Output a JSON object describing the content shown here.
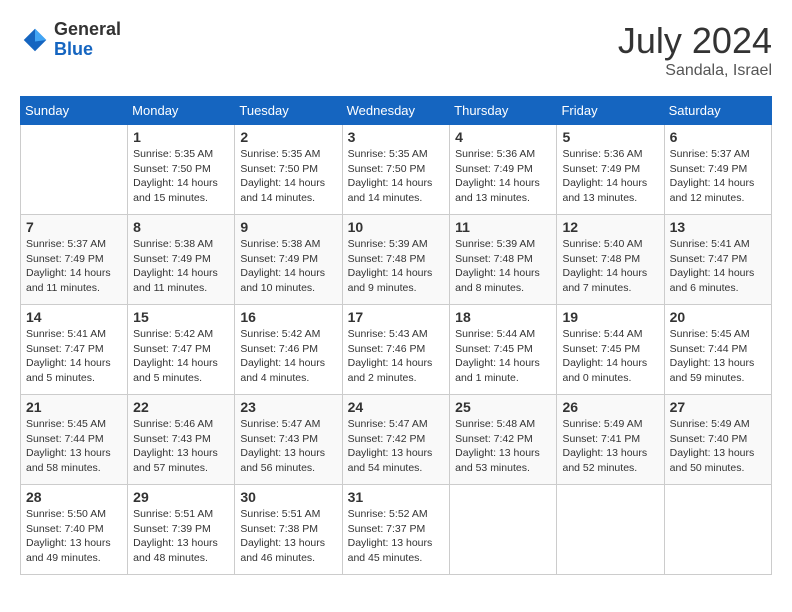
{
  "header": {
    "logo_general": "General",
    "logo_blue": "Blue",
    "month_title": "July 2024",
    "location": "Sandala, Israel"
  },
  "calendar": {
    "columns": [
      "Sunday",
      "Monday",
      "Tuesday",
      "Wednesday",
      "Thursday",
      "Friday",
      "Saturday"
    ],
    "weeks": [
      [
        {
          "day": "",
          "sunrise": "",
          "sunset": "",
          "daylight": ""
        },
        {
          "day": "1",
          "sunrise": "Sunrise: 5:35 AM",
          "sunset": "Sunset: 7:50 PM",
          "daylight": "Daylight: 14 hours and 15 minutes."
        },
        {
          "day": "2",
          "sunrise": "Sunrise: 5:35 AM",
          "sunset": "Sunset: 7:50 PM",
          "daylight": "Daylight: 14 hours and 14 minutes."
        },
        {
          "day": "3",
          "sunrise": "Sunrise: 5:35 AM",
          "sunset": "Sunset: 7:50 PM",
          "daylight": "Daylight: 14 hours and 14 minutes."
        },
        {
          "day": "4",
          "sunrise": "Sunrise: 5:36 AM",
          "sunset": "Sunset: 7:49 PM",
          "daylight": "Daylight: 14 hours and 13 minutes."
        },
        {
          "day": "5",
          "sunrise": "Sunrise: 5:36 AM",
          "sunset": "Sunset: 7:49 PM",
          "daylight": "Daylight: 14 hours and 13 minutes."
        },
        {
          "day": "6",
          "sunrise": "Sunrise: 5:37 AM",
          "sunset": "Sunset: 7:49 PM",
          "daylight": "Daylight: 14 hours and 12 minutes."
        }
      ],
      [
        {
          "day": "7",
          "sunrise": "Sunrise: 5:37 AM",
          "sunset": "Sunset: 7:49 PM",
          "daylight": "Daylight: 14 hours and 11 minutes."
        },
        {
          "day": "8",
          "sunrise": "Sunrise: 5:38 AM",
          "sunset": "Sunset: 7:49 PM",
          "daylight": "Daylight: 14 hours and 11 minutes."
        },
        {
          "day": "9",
          "sunrise": "Sunrise: 5:38 AM",
          "sunset": "Sunset: 7:49 PM",
          "daylight": "Daylight: 14 hours and 10 minutes."
        },
        {
          "day": "10",
          "sunrise": "Sunrise: 5:39 AM",
          "sunset": "Sunset: 7:48 PM",
          "daylight": "Daylight: 14 hours and 9 minutes."
        },
        {
          "day": "11",
          "sunrise": "Sunrise: 5:39 AM",
          "sunset": "Sunset: 7:48 PM",
          "daylight": "Daylight: 14 hours and 8 minutes."
        },
        {
          "day": "12",
          "sunrise": "Sunrise: 5:40 AM",
          "sunset": "Sunset: 7:48 PM",
          "daylight": "Daylight: 14 hours and 7 minutes."
        },
        {
          "day": "13",
          "sunrise": "Sunrise: 5:41 AM",
          "sunset": "Sunset: 7:47 PM",
          "daylight": "Daylight: 14 hours and 6 minutes."
        }
      ],
      [
        {
          "day": "14",
          "sunrise": "Sunrise: 5:41 AM",
          "sunset": "Sunset: 7:47 PM",
          "daylight": "Daylight: 14 hours and 5 minutes."
        },
        {
          "day": "15",
          "sunrise": "Sunrise: 5:42 AM",
          "sunset": "Sunset: 7:47 PM",
          "daylight": "Daylight: 14 hours and 5 minutes."
        },
        {
          "day": "16",
          "sunrise": "Sunrise: 5:42 AM",
          "sunset": "Sunset: 7:46 PM",
          "daylight": "Daylight: 14 hours and 4 minutes."
        },
        {
          "day": "17",
          "sunrise": "Sunrise: 5:43 AM",
          "sunset": "Sunset: 7:46 PM",
          "daylight": "Daylight: 14 hours and 2 minutes."
        },
        {
          "day": "18",
          "sunrise": "Sunrise: 5:44 AM",
          "sunset": "Sunset: 7:45 PM",
          "daylight": "Daylight: 14 hours and 1 minute."
        },
        {
          "day": "19",
          "sunrise": "Sunrise: 5:44 AM",
          "sunset": "Sunset: 7:45 PM",
          "daylight": "Daylight: 14 hours and 0 minutes."
        },
        {
          "day": "20",
          "sunrise": "Sunrise: 5:45 AM",
          "sunset": "Sunset: 7:44 PM",
          "daylight": "Daylight: 13 hours and 59 minutes."
        }
      ],
      [
        {
          "day": "21",
          "sunrise": "Sunrise: 5:45 AM",
          "sunset": "Sunset: 7:44 PM",
          "daylight": "Daylight: 13 hours and 58 minutes."
        },
        {
          "day": "22",
          "sunrise": "Sunrise: 5:46 AM",
          "sunset": "Sunset: 7:43 PM",
          "daylight": "Daylight: 13 hours and 57 minutes."
        },
        {
          "day": "23",
          "sunrise": "Sunrise: 5:47 AM",
          "sunset": "Sunset: 7:43 PM",
          "daylight": "Daylight: 13 hours and 56 minutes."
        },
        {
          "day": "24",
          "sunrise": "Sunrise: 5:47 AM",
          "sunset": "Sunset: 7:42 PM",
          "daylight": "Daylight: 13 hours and 54 minutes."
        },
        {
          "day": "25",
          "sunrise": "Sunrise: 5:48 AM",
          "sunset": "Sunset: 7:42 PM",
          "daylight": "Daylight: 13 hours and 53 minutes."
        },
        {
          "day": "26",
          "sunrise": "Sunrise: 5:49 AM",
          "sunset": "Sunset: 7:41 PM",
          "daylight": "Daylight: 13 hours and 52 minutes."
        },
        {
          "day": "27",
          "sunrise": "Sunrise: 5:49 AM",
          "sunset": "Sunset: 7:40 PM",
          "daylight": "Daylight: 13 hours and 50 minutes."
        }
      ],
      [
        {
          "day": "28",
          "sunrise": "Sunrise: 5:50 AM",
          "sunset": "Sunset: 7:40 PM",
          "daylight": "Daylight: 13 hours and 49 minutes."
        },
        {
          "day": "29",
          "sunrise": "Sunrise: 5:51 AM",
          "sunset": "Sunset: 7:39 PM",
          "daylight": "Daylight: 13 hours and 48 minutes."
        },
        {
          "day": "30",
          "sunrise": "Sunrise: 5:51 AM",
          "sunset": "Sunset: 7:38 PM",
          "daylight": "Daylight: 13 hours and 46 minutes."
        },
        {
          "day": "31",
          "sunrise": "Sunrise: 5:52 AM",
          "sunset": "Sunset: 7:37 PM",
          "daylight": "Daylight: 13 hours and 45 minutes."
        },
        {
          "day": "",
          "sunrise": "",
          "sunset": "",
          "daylight": ""
        },
        {
          "day": "",
          "sunrise": "",
          "sunset": "",
          "daylight": ""
        },
        {
          "day": "",
          "sunrise": "",
          "sunset": "",
          "daylight": ""
        }
      ]
    ]
  }
}
